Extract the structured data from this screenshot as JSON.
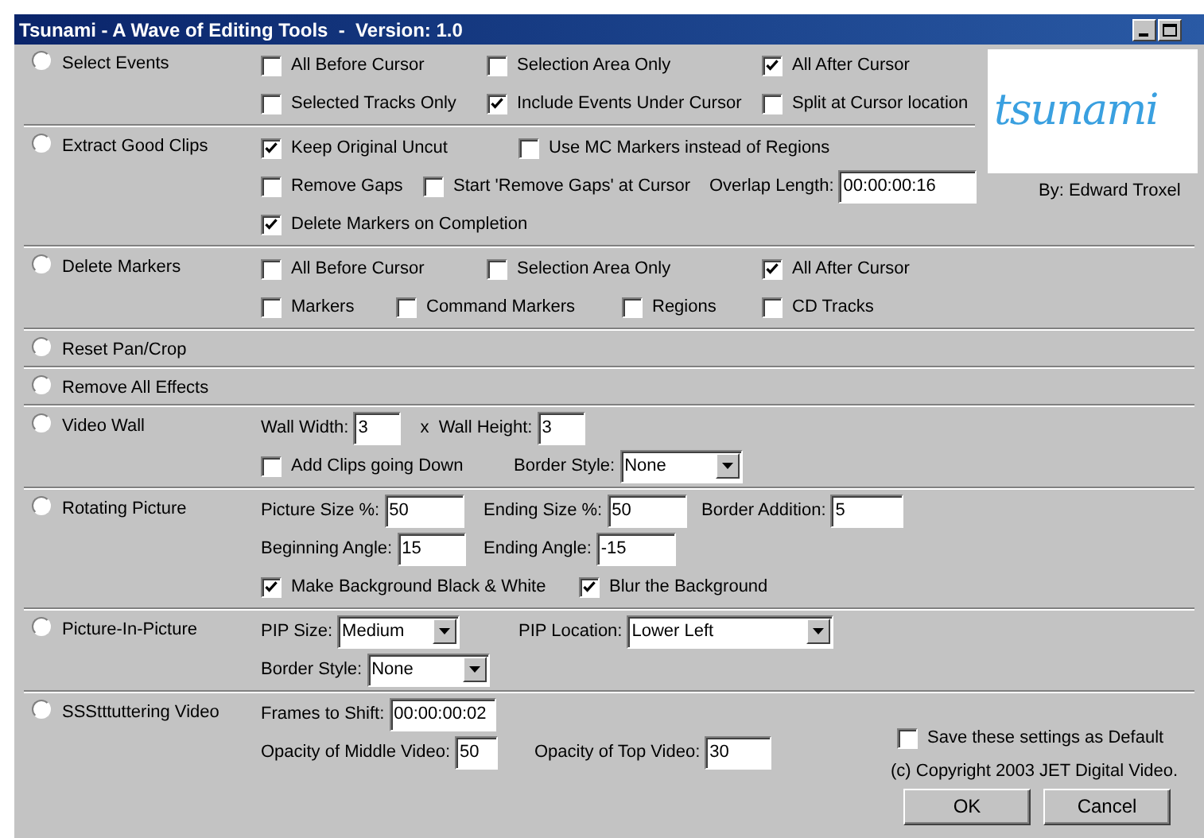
{
  "window": {
    "title": "Tsunami - A Wave of Editing Tools  -  Version: 1.0"
  },
  "logo": {
    "text": "tsunami",
    "byline": "By: Edward Troxel"
  },
  "sections": [
    {
      "label": "Select Events",
      "selected": false,
      "rows": [
        {
          "items": [
            {
              "kind": "checkbox",
              "label": "All Before Cursor",
              "checked": false
            },
            {
              "kind": "checkbox",
              "label": "Selection Area Only",
              "checked": false
            },
            {
              "kind": "checkbox",
              "label": "All After Cursor",
              "checked": true
            }
          ]
        },
        {
          "items": [
            {
              "kind": "checkbox",
              "label": "Selected Tracks Only",
              "checked": false
            },
            {
              "kind": "checkbox",
              "label": "Include Events Under Cursor",
              "checked": true
            },
            {
              "kind": "checkbox",
              "label": "Split at Cursor location",
              "checked": false
            }
          ]
        }
      ]
    },
    {
      "label": "Extract Good Clips",
      "selected": false,
      "rows": [
        {
          "items": [
            {
              "kind": "checkbox",
              "label": "Keep Original Uncut",
              "checked": true
            },
            {
              "kind": "checkbox",
              "label": "Use MC Markers instead of Regions",
              "checked": false
            }
          ]
        },
        {
          "items": [
            {
              "kind": "checkbox",
              "label": "Remove Gaps",
              "checked": false
            },
            {
              "kind": "checkbox",
              "label": "Start 'Remove Gaps' at Cursor",
              "checked": false
            },
            {
              "kind": "field",
              "label": "Overlap Length:",
              "value": "00:00:00:16"
            }
          ]
        },
        {
          "items": [
            {
              "kind": "checkbox",
              "label": "Delete Markers on Completion",
              "checked": true
            }
          ]
        }
      ]
    },
    {
      "label": "Delete Markers",
      "selected": false,
      "rows": [
        {
          "items": [
            {
              "kind": "checkbox",
              "label": "All Before Cursor",
              "checked": false
            },
            {
              "kind": "checkbox",
              "label": "Selection Area Only",
              "checked": false
            },
            {
              "kind": "checkbox",
              "label": "All After Cursor",
              "checked": true
            }
          ]
        },
        {
          "items": [
            {
              "kind": "checkbox",
              "label": "Markers",
              "checked": false
            },
            {
              "kind": "checkbox",
              "label": "Command Markers",
              "checked": false
            },
            {
              "kind": "checkbox",
              "label": "Regions",
              "checked": false
            },
            {
              "kind": "checkbox",
              "label": "CD Tracks",
              "checked": false
            }
          ]
        }
      ]
    },
    {
      "label": "Reset Pan/Crop",
      "selected": false
    },
    {
      "label": "Remove All Effects",
      "selected": false
    },
    {
      "label": "Video Wall",
      "selected": false,
      "rows": [
        {
          "items": [
            {
              "kind": "field",
              "label": "Wall Width:",
              "value": "3"
            },
            {
              "kind": "field",
              "label": "x  Wall Height:",
              "value": "3"
            }
          ]
        },
        {
          "items": [
            {
              "kind": "checkbox",
              "label": "Add Clips going Down",
              "checked": false
            },
            {
              "kind": "dropdown",
              "label": "Border Style:",
              "value": "None"
            }
          ]
        }
      ]
    },
    {
      "label": "Rotating Picture",
      "selected": false,
      "rows": [
        {
          "items": [
            {
              "kind": "field",
              "label": "Picture Size %:",
              "value": "50"
            },
            {
              "kind": "field",
              "label": "Ending Size %:",
              "value": "50"
            },
            {
              "kind": "field",
              "label": "Border Addition:",
              "value": "5"
            }
          ]
        },
        {
          "items": [
            {
              "kind": "field",
              "label": "Beginning Angle:",
              "value": "15"
            },
            {
              "kind": "field",
              "label": "Ending Angle:",
              "value": "-15"
            }
          ]
        },
        {
          "items": [
            {
              "kind": "checkbox",
              "label": "Make Background Black & White",
              "checked": true
            },
            {
              "kind": "checkbox",
              "label": "Blur the Background",
              "checked": true
            }
          ]
        }
      ]
    },
    {
      "label": "Picture-In-Picture",
      "selected": false,
      "rows": [
        {
          "items": [
            {
              "kind": "dropdown",
              "label": "PIP Size:",
              "value": "Medium"
            },
            {
              "kind": "dropdown",
              "label": "PIP Location:",
              "value": "Lower Left"
            }
          ]
        },
        {
          "items": [
            {
              "kind": "dropdown",
              "label": "Border Style:",
              "value": "None"
            }
          ]
        }
      ]
    },
    {
      "label": "SSStttuttering Video",
      "selected": false,
      "rows": [
        {
          "items": [
            {
              "kind": "field",
              "label": "Frames to Shift:",
              "value": "00:00:00:02"
            }
          ]
        },
        {
          "items": [
            {
              "kind": "field",
              "label": "Opacity of Middle Video:",
              "value": "50"
            },
            {
              "kind": "field",
              "label": "Opacity of Top Video:",
              "value": "30"
            }
          ]
        }
      ]
    }
  ],
  "save_default": {
    "label": "Save these settings as Default",
    "checked": false
  },
  "copyright": "(c) Copyright 2003 JET Digital Video.",
  "buttons": [
    "OK",
    "Cancel"
  ]
}
